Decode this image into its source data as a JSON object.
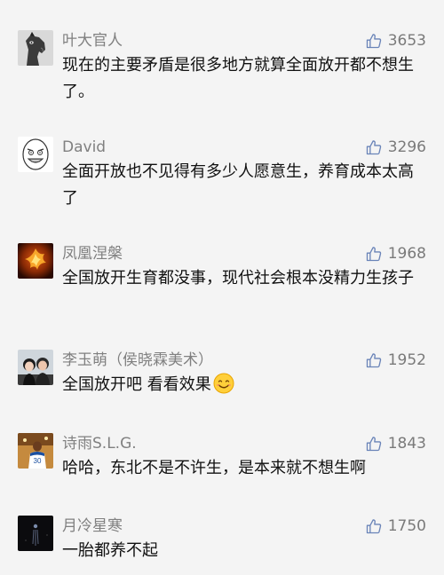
{
  "comments": [
    {
      "username": "叶大官人",
      "likes": "3653",
      "text": "现在的主要矛盾是很多地方就算全面放开都不想生了。",
      "avatar": "horse-head-avatar"
    },
    {
      "username": "David",
      "likes": "3296",
      "text": "全面开放也不见得有多少人愿意生，养育成本太高了",
      "avatar": "rage-face-avatar"
    },
    {
      "username": "凤凰涅槃",
      "likes": "1968",
      "text": "全国放开生育都没事，现代社会根本没精力生孩子",
      "avatar": "phoenix-avatar"
    },
    {
      "username": "李玉萌（侯晓霖美术）",
      "likes": "1952",
      "text": "全国放开吧 看看效果",
      "avatar": "couple-photo-avatar",
      "emoji": "smile-emoji"
    },
    {
      "username": "诗雨S.L.G.",
      "likes": "1843",
      "text": "哈哈，东北不是不许生，是本来就不想生啊",
      "avatar": "basketball-player-avatar"
    },
    {
      "username": "月冷星寒",
      "likes": "1750",
      "text": "一胎都养不起",
      "avatar": "dark-night-avatar"
    }
  ],
  "icons": {
    "like": "thumbs-up-outline-icon"
  },
  "colors": {
    "background": "#f4f4f4",
    "username": "#808080",
    "text": "#111111",
    "like_icon": "#6a84b8",
    "like_count": "#7a7a7a"
  }
}
